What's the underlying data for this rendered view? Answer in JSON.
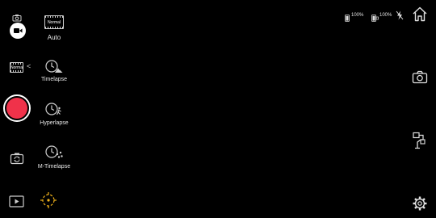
{
  "modes": {
    "auto": {
      "badge": "Normal",
      "label": "Auto"
    },
    "timelapse": {
      "label": "Timelapse"
    },
    "hyperlapse": {
      "label": "Hyperlapse"
    },
    "m_timelapse": {
      "label": "M-Timelapse"
    }
  },
  "left_panel": {
    "film_badge": "Normal",
    "collapse_arrow": "<"
  },
  "status_bar": {
    "phone_battery": "100%",
    "gimbal_battery": "100%"
  },
  "colors": {
    "record_button": "#f0324a",
    "focus_accent": "#f2b31b",
    "background": "#000000"
  },
  "icons": {
    "photo_mode": "camera-icon",
    "video_mode": "video-camera-icon",
    "switch_camera": "camera-switch-icon",
    "playback": "play-icon",
    "focus": "focus-target-icon",
    "home": "home-icon",
    "snapshot": "camera-icon",
    "gimbal": "gimbal-icon",
    "settings": "gear-icon",
    "flash": "flash-off-icon"
  }
}
